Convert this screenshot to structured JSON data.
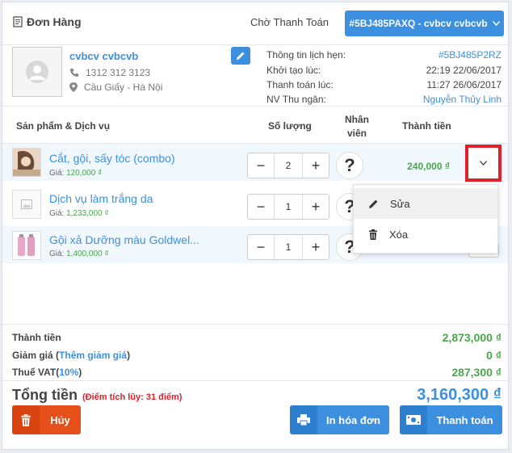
{
  "header": {
    "title": "Đơn Hàng",
    "status": "Chờ Thanh Toán",
    "order_button": "#5BJ485PAXQ - cvbcv cvbcvb"
  },
  "customer": {
    "name": "cvbcv cvbcvb",
    "phone": "1312 312 3123",
    "address": "Cầu Giấy - Hà Nội"
  },
  "info": [
    {
      "label": "Thông tin lịch hẹn:",
      "value": "#5BJ485P2RZ"
    },
    {
      "label": "Khởi tạo lúc:",
      "value": "22:19 22/06/2017"
    },
    {
      "label": "Thanh toán lúc:",
      "value": "11:27 26/06/2017"
    },
    {
      "label": "NV Thu ngân:",
      "value": "Nguyễn Thủy Linh"
    }
  ],
  "table": {
    "col_product": "Sản phẩm & Dịch vụ",
    "col_qty": "Số lượng",
    "col_staff_1": "Nhân",
    "col_staff_2": "viên",
    "col_total": "Thành tiền"
  },
  "items": [
    {
      "name": "Cắt, gội, sấy tóc (combo)",
      "price_label": "Giá:",
      "price": "120,000 ₫",
      "qty": "2",
      "staff": "?",
      "total": "240,000 ₫"
    },
    {
      "name": "Dịch vụ làm trắng da",
      "price_label": "Giá:",
      "price": "1,233,000 ₫",
      "qty": "1",
      "staff": "?",
      "total": ""
    },
    {
      "name": "Gội xả Dưỡng màu Goldwel...",
      "price_label": "Giá:",
      "price": "1,400,000 ₫",
      "qty": "1",
      "staff": "?",
      "total": ""
    }
  ],
  "stepper": {
    "minus": "−",
    "plus": "+"
  },
  "dropdown": {
    "edit": "Sửa",
    "delete": "Xóa"
  },
  "summary": {
    "subtotal_label": "Thành tiền",
    "subtotal": "2,873,000 ₫",
    "discount_label": "Giảm giá",
    "discount_link": "Thêm giảm giá",
    "discount": "0 ₫",
    "vat_label": "Thuế VAT",
    "vat_rate": "10%",
    "vat": "287,300 ₫",
    "grand_label": "Tổng tiền",
    "points": "(Điểm tích lũy: 31 điểm)",
    "grand": "3,160,300 ₫"
  },
  "actions": {
    "cancel": "Hủy",
    "print": "In hóa đơn",
    "pay": "Thanh toán"
  },
  "colors": {
    "primary": "#3d8fe0",
    "danger": "#e8501a",
    "success": "#4aa64a",
    "highlight": "#e0202a"
  },
  "icons": [
    "receipt-icon",
    "user-avatar-icon",
    "pencil-icon",
    "phone-icon",
    "map-pin-icon",
    "chevron-down-icon",
    "trash-icon",
    "printer-icon",
    "cash-icon"
  ]
}
